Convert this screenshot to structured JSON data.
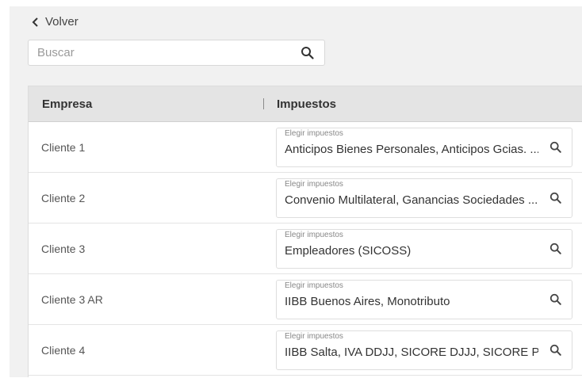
{
  "nav": {
    "back_label": "Volver"
  },
  "search": {
    "placeholder": "Buscar"
  },
  "table": {
    "headers": {
      "empresa": "Empresa",
      "impuestos": "Impuestos"
    },
    "field_label": "Elegir impuestos",
    "rows": [
      {
        "empresa": "Cliente 1",
        "impuestos": "Anticipos Bienes Personales, Anticipos Gcias. ..."
      },
      {
        "empresa": "Cliente 2",
        "impuestos": "Convenio Multilateral, Ganancias Sociedades ..."
      },
      {
        "empresa": "Cliente 3",
        "impuestos": "Empleadores (SICOSS)"
      },
      {
        "empresa": "Cliente 3 AR",
        "impuestos": "IIBB Buenos Aires, Monotributo"
      },
      {
        "empresa": "Cliente 4",
        "impuestos": "IIBB Salta, IVA DDJJ, SICORE DJJJ, SICORE Pago ..."
      }
    ]
  },
  "icons": {
    "back": "chevron-left-icon",
    "search": "search-icon"
  }
}
